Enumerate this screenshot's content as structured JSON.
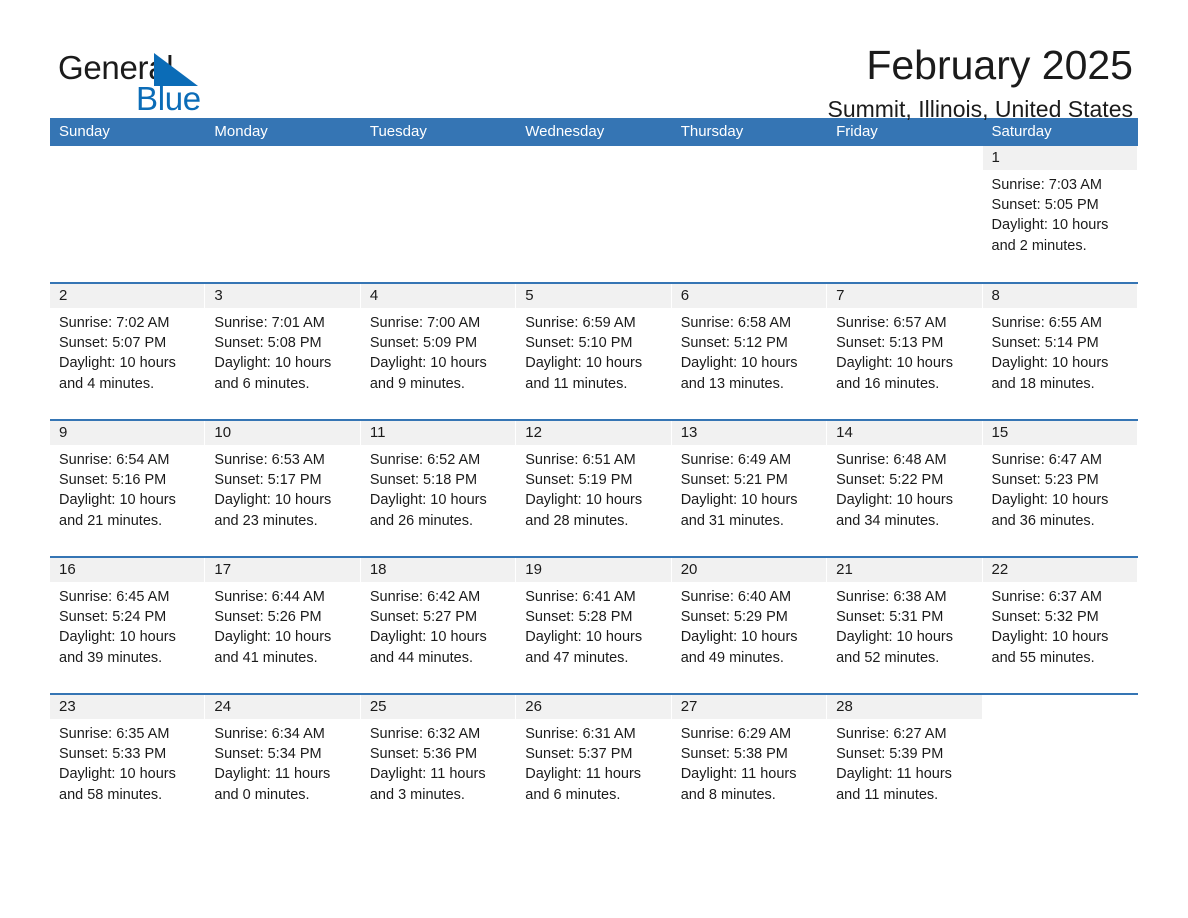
{
  "brand": {
    "name_part1": "General",
    "name_part2": "Blue",
    "triangle_color": "#0b6cb7"
  },
  "header": {
    "title": "February 2025",
    "subtitle": "Summit, Illinois, United States"
  },
  "colors": {
    "header_blue": "#3575b4",
    "row_rule_blue": "#3575b4",
    "daynum_band": "#f1f1f1",
    "text": "#1b1b1b",
    "brand_blue": "#0b6cb7"
  },
  "weekdays": [
    "Sunday",
    "Monday",
    "Tuesday",
    "Wednesday",
    "Thursday",
    "Friday",
    "Saturday"
  ],
  "weeks": [
    [
      {
        "day": "",
        "blank": true
      },
      {
        "day": "",
        "blank": true
      },
      {
        "day": "",
        "blank": true
      },
      {
        "day": "",
        "blank": true
      },
      {
        "day": "",
        "blank": true
      },
      {
        "day": "",
        "blank": true
      },
      {
        "day": "1",
        "sunrise": "Sunrise: 7:03 AM",
        "sunset": "Sunset: 5:05 PM",
        "daylight": "Daylight: 10 hours and 2 minutes."
      }
    ],
    [
      {
        "day": "2",
        "sunrise": "Sunrise: 7:02 AM",
        "sunset": "Sunset: 5:07 PM",
        "daylight": "Daylight: 10 hours and 4 minutes."
      },
      {
        "day": "3",
        "sunrise": "Sunrise: 7:01 AM",
        "sunset": "Sunset: 5:08 PM",
        "daylight": "Daylight: 10 hours and 6 minutes."
      },
      {
        "day": "4",
        "sunrise": "Sunrise: 7:00 AM",
        "sunset": "Sunset: 5:09 PM",
        "daylight": "Daylight: 10 hours and 9 minutes."
      },
      {
        "day": "5",
        "sunrise": "Sunrise: 6:59 AM",
        "sunset": "Sunset: 5:10 PM",
        "daylight": "Daylight: 10 hours and 11 minutes."
      },
      {
        "day": "6",
        "sunrise": "Sunrise: 6:58 AM",
        "sunset": "Sunset: 5:12 PM",
        "daylight": "Daylight: 10 hours and 13 minutes."
      },
      {
        "day": "7",
        "sunrise": "Sunrise: 6:57 AM",
        "sunset": "Sunset: 5:13 PM",
        "daylight": "Daylight: 10 hours and 16 minutes."
      },
      {
        "day": "8",
        "sunrise": "Sunrise: 6:55 AM",
        "sunset": "Sunset: 5:14 PM",
        "daylight": "Daylight: 10 hours and 18 minutes."
      }
    ],
    [
      {
        "day": "9",
        "sunrise": "Sunrise: 6:54 AM",
        "sunset": "Sunset: 5:16 PM",
        "daylight": "Daylight: 10 hours and 21 minutes."
      },
      {
        "day": "10",
        "sunrise": "Sunrise: 6:53 AM",
        "sunset": "Sunset: 5:17 PM",
        "daylight": "Daylight: 10 hours and 23 minutes."
      },
      {
        "day": "11",
        "sunrise": "Sunrise: 6:52 AM",
        "sunset": "Sunset: 5:18 PM",
        "daylight": "Daylight: 10 hours and 26 minutes."
      },
      {
        "day": "12",
        "sunrise": "Sunrise: 6:51 AM",
        "sunset": "Sunset: 5:19 PM",
        "daylight": "Daylight: 10 hours and 28 minutes."
      },
      {
        "day": "13",
        "sunrise": "Sunrise: 6:49 AM",
        "sunset": "Sunset: 5:21 PM",
        "daylight": "Daylight: 10 hours and 31 minutes."
      },
      {
        "day": "14",
        "sunrise": "Sunrise: 6:48 AM",
        "sunset": "Sunset: 5:22 PM",
        "daylight": "Daylight: 10 hours and 34 minutes."
      },
      {
        "day": "15",
        "sunrise": "Sunrise: 6:47 AM",
        "sunset": "Sunset: 5:23 PM",
        "daylight": "Daylight: 10 hours and 36 minutes."
      }
    ],
    [
      {
        "day": "16",
        "sunrise": "Sunrise: 6:45 AM",
        "sunset": "Sunset: 5:24 PM",
        "daylight": "Daylight: 10 hours and 39 minutes."
      },
      {
        "day": "17",
        "sunrise": "Sunrise: 6:44 AM",
        "sunset": "Sunset: 5:26 PM",
        "daylight": "Daylight: 10 hours and 41 minutes."
      },
      {
        "day": "18",
        "sunrise": "Sunrise: 6:42 AM",
        "sunset": "Sunset: 5:27 PM",
        "daylight": "Daylight: 10 hours and 44 minutes."
      },
      {
        "day": "19",
        "sunrise": "Sunrise: 6:41 AM",
        "sunset": "Sunset: 5:28 PM",
        "daylight": "Daylight: 10 hours and 47 minutes."
      },
      {
        "day": "20",
        "sunrise": "Sunrise: 6:40 AM",
        "sunset": "Sunset: 5:29 PM",
        "daylight": "Daylight: 10 hours and 49 minutes."
      },
      {
        "day": "21",
        "sunrise": "Sunrise: 6:38 AM",
        "sunset": "Sunset: 5:31 PM",
        "daylight": "Daylight: 10 hours and 52 minutes."
      },
      {
        "day": "22",
        "sunrise": "Sunrise: 6:37 AM",
        "sunset": "Sunset: 5:32 PM",
        "daylight": "Daylight: 10 hours and 55 minutes."
      }
    ],
    [
      {
        "day": "23",
        "sunrise": "Sunrise: 6:35 AM",
        "sunset": "Sunset: 5:33 PM",
        "daylight": "Daylight: 10 hours and 58 minutes."
      },
      {
        "day": "24",
        "sunrise": "Sunrise: 6:34 AM",
        "sunset": "Sunset: 5:34 PM",
        "daylight": "Daylight: 11 hours and 0 minutes."
      },
      {
        "day": "25",
        "sunrise": "Sunrise: 6:32 AM",
        "sunset": "Sunset: 5:36 PM",
        "daylight": "Daylight: 11 hours and 3 minutes."
      },
      {
        "day": "26",
        "sunrise": "Sunrise: 6:31 AM",
        "sunset": "Sunset: 5:37 PM",
        "daylight": "Daylight: 11 hours and 6 minutes."
      },
      {
        "day": "27",
        "sunrise": "Sunrise: 6:29 AM",
        "sunset": "Sunset: 5:38 PM",
        "daylight": "Daylight: 11 hours and 8 minutes."
      },
      {
        "day": "28",
        "sunrise": "Sunrise: 6:27 AM",
        "sunset": "Sunset: 5:39 PM",
        "daylight": "Daylight: 11 hours and 11 minutes."
      },
      {
        "day": "",
        "blank": true
      }
    ]
  ]
}
